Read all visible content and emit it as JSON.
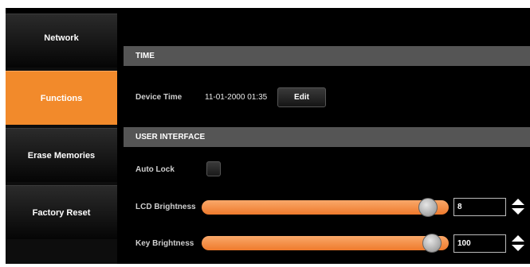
{
  "sidebar": {
    "items": [
      {
        "label": "Network",
        "active": false
      },
      {
        "label": "Functions",
        "active": true
      },
      {
        "label": "Erase Memories",
        "active": false
      },
      {
        "label": "Factory Reset",
        "active": false
      }
    ]
  },
  "time_section": {
    "header": "TIME",
    "device_time_label": "Device Time",
    "device_time_value": "11-01-2000 01:35",
    "edit_label": "Edit"
  },
  "ui_section": {
    "header": "USER INTERFACE",
    "auto_lock_label": "Auto Lock",
    "auto_lock_checked": false,
    "lcd_brightness_label": "LCD Brightness",
    "lcd_brightness_value": "8",
    "lcd_brightness_level": 0.95,
    "key_brightness_label": "Key Brightness",
    "key_brightness_value": "100",
    "key_brightness_level": 0.97
  },
  "colors": {
    "accent": "#f28a2b",
    "header_bg": "#555555",
    "background": "#000000"
  },
  "icons": {
    "stepper": "up-down-arrows-icon"
  }
}
